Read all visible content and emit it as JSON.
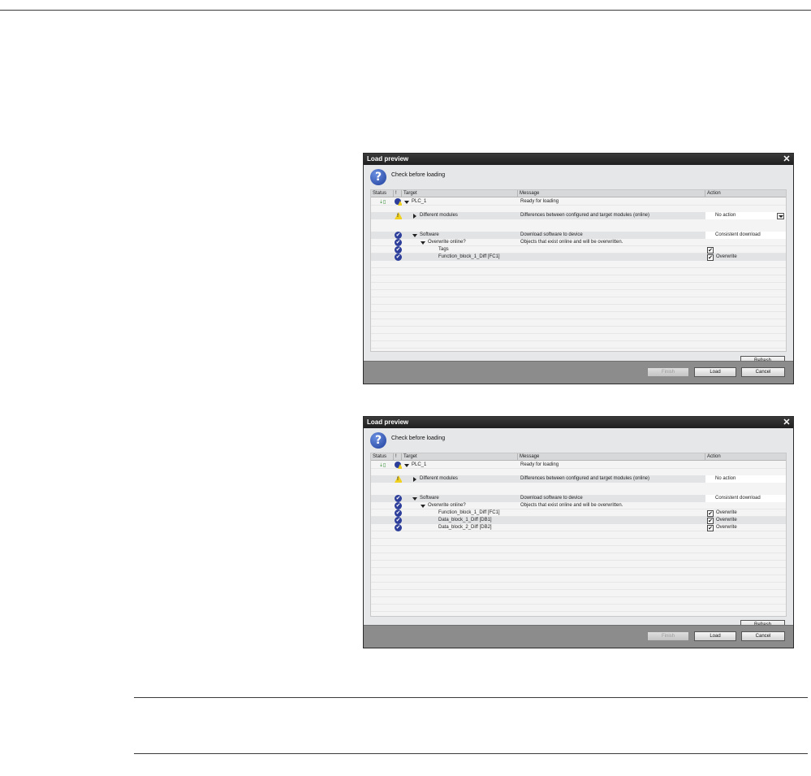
{
  "dialog_top": {
    "title": "Load preview",
    "close_glyph": "✕",
    "heading": "Check before loading",
    "columns": {
      "status": "Status",
      "bang": "!",
      "target": "Target",
      "message": "Message",
      "action": "Action"
    },
    "rows": {
      "plc": {
        "target": "PLC_1",
        "message": "Ready for loading"
      },
      "modules": {
        "target": "Different modules",
        "message": "Differences between configured and target modules (online)",
        "action": "No action"
      },
      "software": {
        "target": "Software",
        "message": "Download software to device",
        "action": "Consistent download"
      },
      "overwrite": {
        "target": "Overwrite online?",
        "message": "Objects that exist online and will be overwritten."
      },
      "tags": {
        "target": "Tags"
      },
      "fb": {
        "target": "Function_block_1_Diff [FC1]",
        "action": "Overwrite"
      }
    },
    "buttons": {
      "refresh": "Refresh",
      "finish": "Finish",
      "load": "Load",
      "cancel": "Cancel"
    }
  },
  "dialog_bottom": {
    "title": "Load preview",
    "close_glyph": "✕",
    "heading": "Check before loading",
    "columns": {
      "status": "Status",
      "bang": "!",
      "target": "Target",
      "message": "Message",
      "action": "Action"
    },
    "rows": {
      "plc": {
        "target": "PLC_1",
        "message": "Ready for loading"
      },
      "modules": {
        "target": "Different modules",
        "message": "Differences between configured and target modules (online)",
        "action": "No action"
      },
      "software": {
        "target": "Software",
        "message": "Download software to device",
        "action": "Consistent download"
      },
      "overwrite": {
        "target": "Overwrite online?",
        "message": "Objects that exist online and will be overwritten."
      },
      "fb": {
        "target": "Function_block_1_Diff [FC1]",
        "action": "Overwrite"
      },
      "db1": {
        "target": "Data_block_1_Diff [DB1]",
        "action": "Overwrite"
      },
      "db2": {
        "target": "Data_block_2_Diff [DB2]",
        "action": "Overwrite"
      }
    },
    "buttons": {
      "refresh": "Refresh",
      "finish": "Finish",
      "load": "Load",
      "cancel": "Cancel"
    }
  },
  "icons": {
    "question": "?",
    "check": "✔",
    "status_plc": "⇣▯",
    "warning": "!"
  }
}
